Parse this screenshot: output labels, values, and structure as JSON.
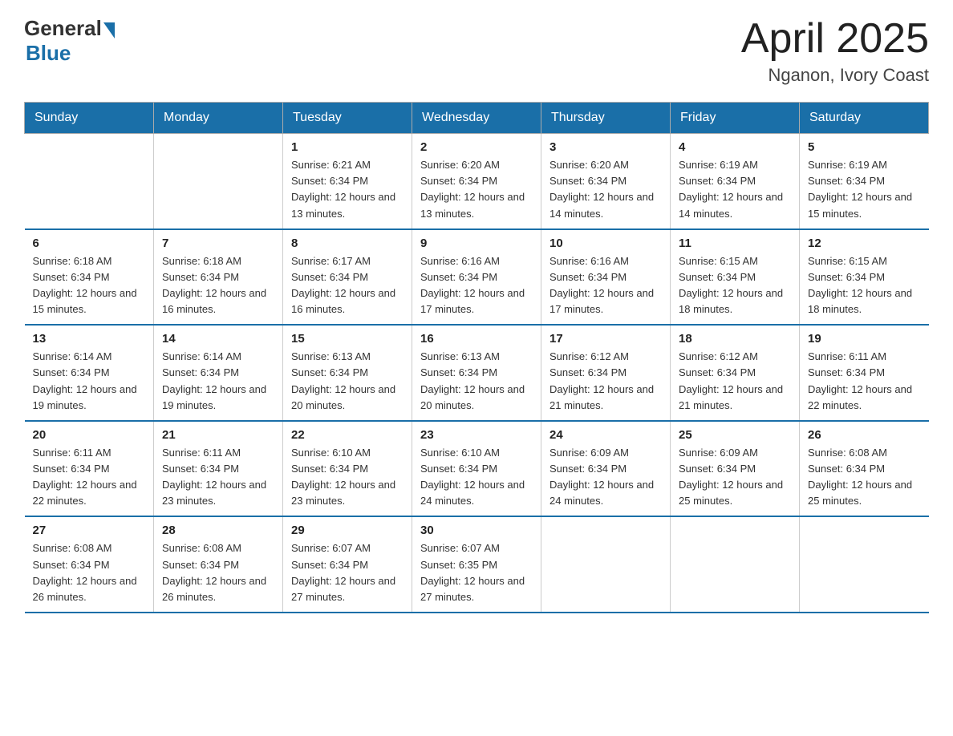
{
  "header": {
    "logo_general": "General",
    "logo_blue": "Blue",
    "month_title": "April 2025",
    "location": "Nganon, Ivory Coast"
  },
  "weekdays": [
    "Sunday",
    "Monday",
    "Tuesday",
    "Wednesday",
    "Thursday",
    "Friday",
    "Saturday"
  ],
  "weeks": [
    [
      {
        "day": "",
        "sunrise": "",
        "sunset": "",
        "daylight": ""
      },
      {
        "day": "",
        "sunrise": "",
        "sunset": "",
        "daylight": ""
      },
      {
        "day": "1",
        "sunrise": "Sunrise: 6:21 AM",
        "sunset": "Sunset: 6:34 PM",
        "daylight": "Daylight: 12 hours and 13 minutes."
      },
      {
        "day": "2",
        "sunrise": "Sunrise: 6:20 AM",
        "sunset": "Sunset: 6:34 PM",
        "daylight": "Daylight: 12 hours and 13 minutes."
      },
      {
        "day": "3",
        "sunrise": "Sunrise: 6:20 AM",
        "sunset": "Sunset: 6:34 PM",
        "daylight": "Daylight: 12 hours and 14 minutes."
      },
      {
        "day": "4",
        "sunrise": "Sunrise: 6:19 AM",
        "sunset": "Sunset: 6:34 PM",
        "daylight": "Daylight: 12 hours and 14 minutes."
      },
      {
        "day": "5",
        "sunrise": "Sunrise: 6:19 AM",
        "sunset": "Sunset: 6:34 PM",
        "daylight": "Daylight: 12 hours and 15 minutes."
      }
    ],
    [
      {
        "day": "6",
        "sunrise": "Sunrise: 6:18 AM",
        "sunset": "Sunset: 6:34 PM",
        "daylight": "Daylight: 12 hours and 15 minutes."
      },
      {
        "day": "7",
        "sunrise": "Sunrise: 6:18 AM",
        "sunset": "Sunset: 6:34 PM",
        "daylight": "Daylight: 12 hours and 16 minutes."
      },
      {
        "day": "8",
        "sunrise": "Sunrise: 6:17 AM",
        "sunset": "Sunset: 6:34 PM",
        "daylight": "Daylight: 12 hours and 16 minutes."
      },
      {
        "day": "9",
        "sunrise": "Sunrise: 6:16 AM",
        "sunset": "Sunset: 6:34 PM",
        "daylight": "Daylight: 12 hours and 17 minutes."
      },
      {
        "day": "10",
        "sunrise": "Sunrise: 6:16 AM",
        "sunset": "Sunset: 6:34 PM",
        "daylight": "Daylight: 12 hours and 17 minutes."
      },
      {
        "day": "11",
        "sunrise": "Sunrise: 6:15 AM",
        "sunset": "Sunset: 6:34 PM",
        "daylight": "Daylight: 12 hours and 18 minutes."
      },
      {
        "day": "12",
        "sunrise": "Sunrise: 6:15 AM",
        "sunset": "Sunset: 6:34 PM",
        "daylight": "Daylight: 12 hours and 18 minutes."
      }
    ],
    [
      {
        "day": "13",
        "sunrise": "Sunrise: 6:14 AM",
        "sunset": "Sunset: 6:34 PM",
        "daylight": "Daylight: 12 hours and 19 minutes."
      },
      {
        "day": "14",
        "sunrise": "Sunrise: 6:14 AM",
        "sunset": "Sunset: 6:34 PM",
        "daylight": "Daylight: 12 hours and 19 minutes."
      },
      {
        "day": "15",
        "sunrise": "Sunrise: 6:13 AM",
        "sunset": "Sunset: 6:34 PM",
        "daylight": "Daylight: 12 hours and 20 minutes."
      },
      {
        "day": "16",
        "sunrise": "Sunrise: 6:13 AM",
        "sunset": "Sunset: 6:34 PM",
        "daylight": "Daylight: 12 hours and 20 minutes."
      },
      {
        "day": "17",
        "sunrise": "Sunrise: 6:12 AM",
        "sunset": "Sunset: 6:34 PM",
        "daylight": "Daylight: 12 hours and 21 minutes."
      },
      {
        "day": "18",
        "sunrise": "Sunrise: 6:12 AM",
        "sunset": "Sunset: 6:34 PM",
        "daylight": "Daylight: 12 hours and 21 minutes."
      },
      {
        "day": "19",
        "sunrise": "Sunrise: 6:11 AM",
        "sunset": "Sunset: 6:34 PM",
        "daylight": "Daylight: 12 hours and 22 minutes."
      }
    ],
    [
      {
        "day": "20",
        "sunrise": "Sunrise: 6:11 AM",
        "sunset": "Sunset: 6:34 PM",
        "daylight": "Daylight: 12 hours and 22 minutes."
      },
      {
        "day": "21",
        "sunrise": "Sunrise: 6:11 AM",
        "sunset": "Sunset: 6:34 PM",
        "daylight": "Daylight: 12 hours and 23 minutes."
      },
      {
        "day": "22",
        "sunrise": "Sunrise: 6:10 AM",
        "sunset": "Sunset: 6:34 PM",
        "daylight": "Daylight: 12 hours and 23 minutes."
      },
      {
        "day": "23",
        "sunrise": "Sunrise: 6:10 AM",
        "sunset": "Sunset: 6:34 PM",
        "daylight": "Daylight: 12 hours and 24 minutes."
      },
      {
        "day": "24",
        "sunrise": "Sunrise: 6:09 AM",
        "sunset": "Sunset: 6:34 PM",
        "daylight": "Daylight: 12 hours and 24 minutes."
      },
      {
        "day": "25",
        "sunrise": "Sunrise: 6:09 AM",
        "sunset": "Sunset: 6:34 PM",
        "daylight": "Daylight: 12 hours and 25 minutes."
      },
      {
        "day": "26",
        "sunrise": "Sunrise: 6:08 AM",
        "sunset": "Sunset: 6:34 PM",
        "daylight": "Daylight: 12 hours and 25 minutes."
      }
    ],
    [
      {
        "day": "27",
        "sunrise": "Sunrise: 6:08 AM",
        "sunset": "Sunset: 6:34 PM",
        "daylight": "Daylight: 12 hours and 26 minutes."
      },
      {
        "day": "28",
        "sunrise": "Sunrise: 6:08 AM",
        "sunset": "Sunset: 6:34 PM",
        "daylight": "Daylight: 12 hours and 26 minutes."
      },
      {
        "day": "29",
        "sunrise": "Sunrise: 6:07 AM",
        "sunset": "Sunset: 6:34 PM",
        "daylight": "Daylight: 12 hours and 27 minutes."
      },
      {
        "day": "30",
        "sunrise": "Sunrise: 6:07 AM",
        "sunset": "Sunset: 6:35 PM",
        "daylight": "Daylight: 12 hours and 27 minutes."
      },
      {
        "day": "",
        "sunrise": "",
        "sunset": "",
        "daylight": ""
      },
      {
        "day": "",
        "sunrise": "",
        "sunset": "",
        "daylight": ""
      },
      {
        "day": "",
        "sunrise": "",
        "sunset": "",
        "daylight": ""
      }
    ]
  ]
}
